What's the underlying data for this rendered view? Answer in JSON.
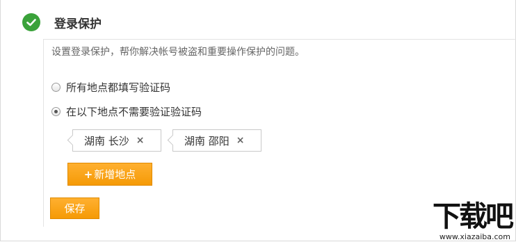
{
  "panel": {
    "title": "登录保护",
    "description": "设置登录保护，帮你解决帐号被盗和重要操作保护的问题。",
    "options": [
      {
        "label": "所有地点都填写验证码",
        "checked": false
      },
      {
        "label": "在以下地点不需要验证验证码",
        "checked": true
      }
    ],
    "locations": [
      {
        "label": "湖南 长沙",
        "remove": "×"
      },
      {
        "label": "湖南 邵阳",
        "remove": "×"
      }
    ],
    "add_label": "新增地点",
    "add_icon": "+",
    "save_label": "保存"
  },
  "watermark": {
    "logo": "下载吧",
    "url": "www.xiazaiba.com"
  },
  "colors": {
    "accent": "#f59a06",
    "success": "#3aa23a"
  }
}
